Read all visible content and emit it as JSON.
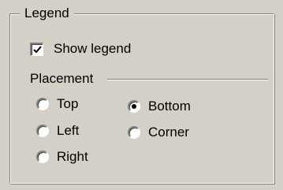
{
  "legend_group": {
    "title": "Legend",
    "show_legend": {
      "label": "Show legend",
      "checked": true
    }
  },
  "placement": {
    "label": "Placement",
    "options": [
      {
        "label": "Top",
        "selected": false
      },
      {
        "label": "Left",
        "selected": false
      },
      {
        "label": "Right",
        "selected": false
      },
      {
        "label": "Bottom",
        "selected": true
      },
      {
        "label": "Corner",
        "selected": false
      }
    ]
  }
}
